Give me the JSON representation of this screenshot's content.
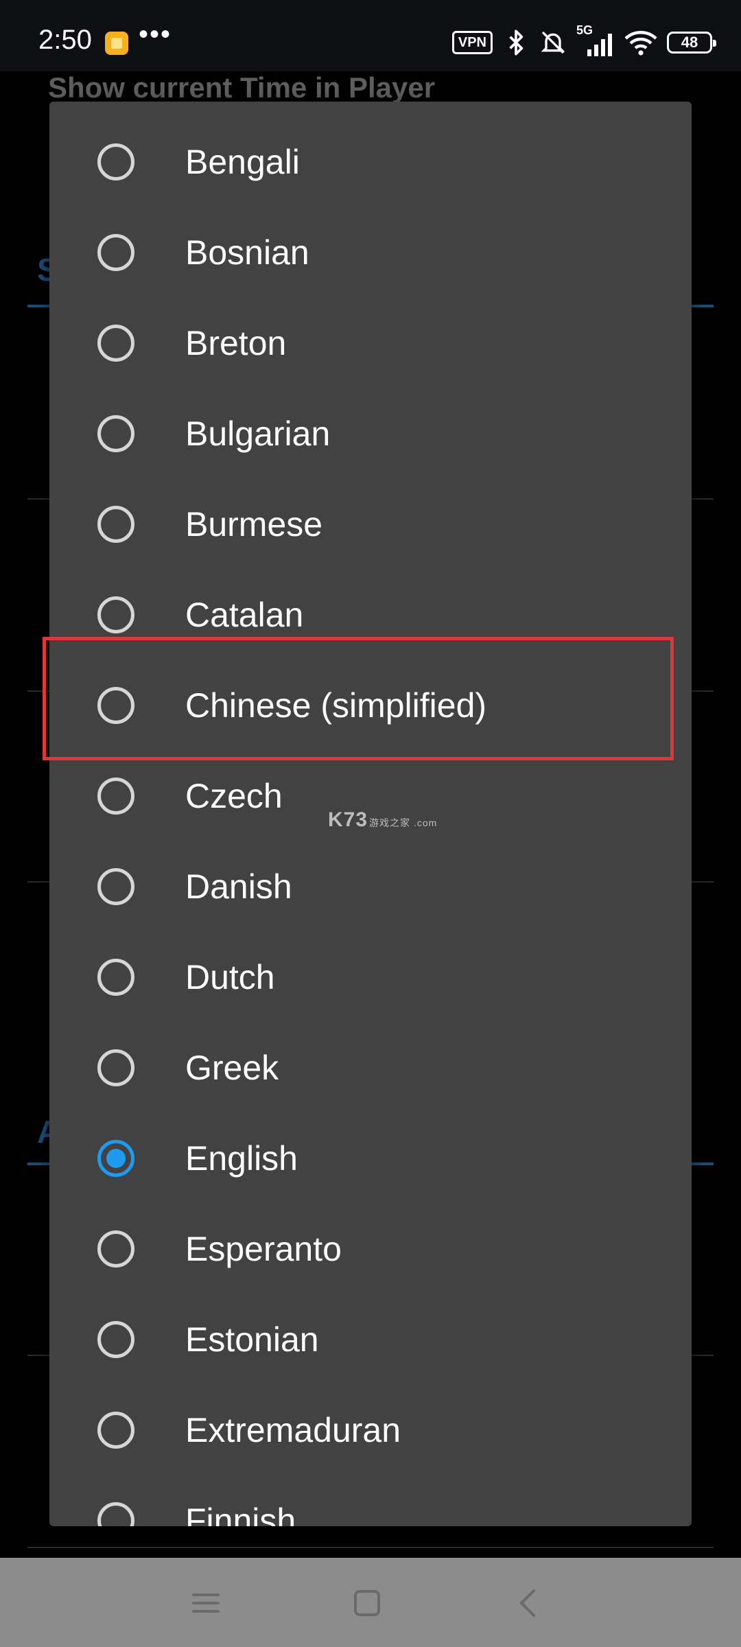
{
  "status_bar": {
    "time": "2:50",
    "more": "•••",
    "vpn": "VPN",
    "network": "5G",
    "battery": "48",
    "icons": [
      "app-notification-icon",
      "bluetooth-icon",
      "bell-muted-icon",
      "signal-icon",
      "wifi-icon",
      "battery-icon"
    ]
  },
  "background_page": {
    "title": "Show current Time in Player",
    "section_letter_1": "S",
    "section_letter_2": "A"
  },
  "dialog": {
    "options": [
      {
        "label": "Bengali",
        "selected": false
      },
      {
        "label": "Bosnian",
        "selected": false
      },
      {
        "label": "Breton",
        "selected": false
      },
      {
        "label": "Bulgarian",
        "selected": false
      },
      {
        "label": "Burmese",
        "selected": false
      },
      {
        "label": "Catalan",
        "selected": false
      },
      {
        "label": "Chinese (simplified)",
        "selected": false
      },
      {
        "label": "Czech",
        "selected": false
      },
      {
        "label": "Danish",
        "selected": false
      },
      {
        "label": "Dutch",
        "selected": false
      },
      {
        "label": "Greek",
        "selected": false
      },
      {
        "label": "English",
        "selected": true
      },
      {
        "label": "Esperanto",
        "selected": false
      },
      {
        "label": "Estonian",
        "selected": false
      },
      {
        "label": "Extremaduran",
        "selected": false
      },
      {
        "label": "Finnish",
        "selected": false
      }
    ]
  },
  "watermark": {
    "brand": "K73",
    "sub": "游戏之家 .com"
  },
  "nav_bar": {
    "icons": [
      "menu-icon",
      "home-icon",
      "back-icon"
    ]
  },
  "colors": {
    "accent": "#1e9bef",
    "highlight": "#e0353b",
    "dialog_bg": "#424242"
  }
}
